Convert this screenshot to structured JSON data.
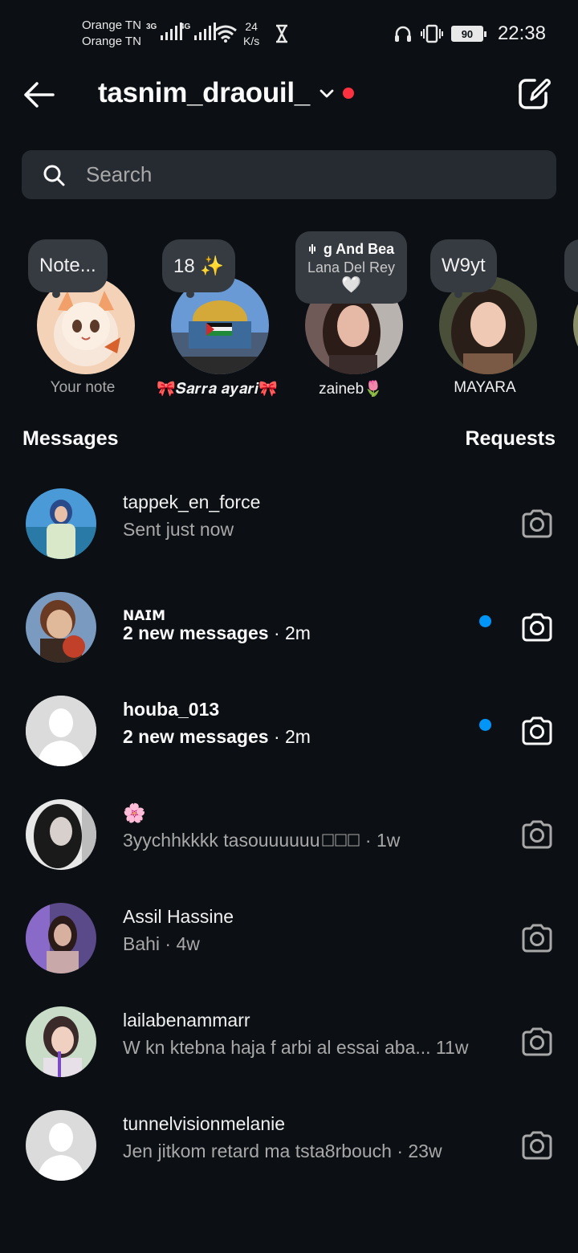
{
  "status_bar": {
    "carrier_1": "Orange TN",
    "carrier_2": "Orange TN",
    "net_1": "3G",
    "net_2": "4G",
    "speed_value": "24",
    "speed_unit": "K/s",
    "battery": "90",
    "time": "22:38"
  },
  "header": {
    "username": "tasnim_draouil_",
    "has_unread_indicator": true
  },
  "search": {
    "placeholder": "Search"
  },
  "notes": [
    {
      "note": "Note...",
      "name": "Your note"
    },
    {
      "note": "18 ✨",
      "name": "🎀𝑺𝒂𝒓𝒓𝒂 𝒂𝒚𝒂𝒓𝒊🎀"
    },
    {
      "song": "g And Bea",
      "artist": "Lana Del Rey",
      "heart": "🤍",
      "name": "zaineb🌷"
    },
    {
      "note": "W9yt",
      "name": "MAYARA"
    }
  ],
  "sections": {
    "messages": "Messages",
    "requests": "Requests"
  },
  "threads": [
    {
      "name": "tappek_en_force",
      "preview": "Sent just now",
      "time": "",
      "unread": false
    },
    {
      "name": "𝗡𝗔𝗜𝗠",
      "preview": "2 new messages",
      "time": " · 2m",
      "unread": true
    },
    {
      "name": "houba_013",
      "preview": "2 new messages",
      "time": " · 2m",
      "unread": true
    },
    {
      "name": "🌸",
      "preview": "3yychhkkkk tasouuuuuu",
      "time": " · 1w",
      "unread": false
    },
    {
      "name": "Assil Hassine",
      "preview": "Bahi",
      "time": " · 4w",
      "unread": false
    },
    {
      "name": "lailabenammarr",
      "preview": "W kn ktebna haja f arbi al essai aba...",
      "time": " 11w",
      "unread": false
    },
    {
      "name": "tunnelvisionmelanie",
      "preview": "Jen jitkom retard ma tsta8rbouch",
      "time": " · 23w",
      "unread": false
    }
  ],
  "colors": {
    "background": "#0c1014",
    "unread_dot": "#0095f6",
    "notification_dot": "#ff3040"
  }
}
